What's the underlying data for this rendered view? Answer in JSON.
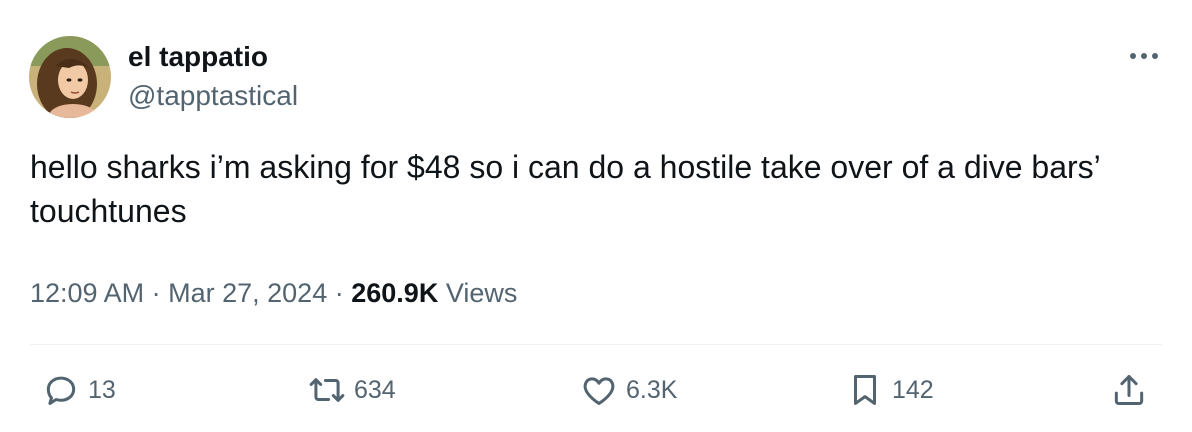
{
  "author": {
    "display_name": "el tappatio",
    "handle": "@tapptastical"
  },
  "tweet": {
    "text": "hello sharks i’m asking for $48 so i can do a hostile take over of a dive bars’ touchtunes",
    "time": "12:09 AM",
    "date": "Mar 27, 2024",
    "separator": "·",
    "views_count": "260.9K",
    "views_label": "Views"
  },
  "actions": {
    "replies": "13",
    "retweets": "634",
    "likes": "6.3K",
    "bookmarks": "142"
  },
  "icons": [
    "more-icon",
    "reply-icon",
    "retweet-icon",
    "like-icon",
    "bookmark-icon",
    "share-icon"
  ],
  "colors": {
    "text": "#0f1419",
    "secondary": "#536471",
    "divider": "#eff3f4"
  }
}
